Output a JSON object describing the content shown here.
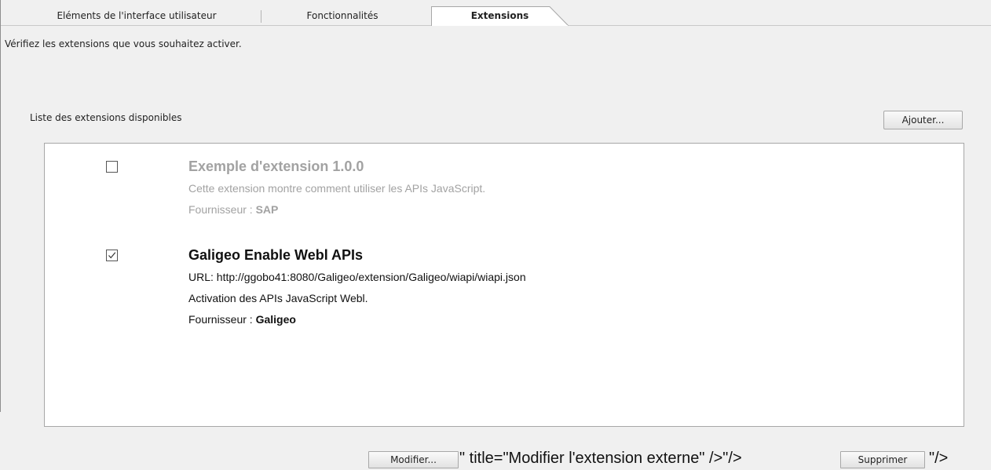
{
  "tabs": [
    {
      "label": "Eléments de l'interface utilisateur",
      "active": false
    },
    {
      "label": "Fonctionnalités",
      "active": false
    },
    {
      "label": "Extensions",
      "active": true
    }
  ],
  "instructions": "Vérifiez les extensions que vous souhaitez activer.",
  "list_label": "Liste des extensions disponibles",
  "add_button_label": "Ajouter...",
  "extensions": [
    {
      "enabled": false,
      "title": "Exemple d'extension 1.0.0",
      "description": "Cette extension montre comment utiliser les APIs JavaScript.",
      "provider_label": "Fournisseur : ",
      "provider": "SAP"
    },
    {
      "enabled": true,
      "title": "Galigeo Enable Webl APIs",
      "url_line": "URL: http://ggobo41:8080/Galigeo/extension/Galigeo/wiapi/wiapi.json",
      "description": "Activation des APIs JavaScript Webl.",
      "provider_label": "Fournisseur : ",
      "provider": "Galigeo",
      "modify_label": "Modifier...",
      "modify_trailing_text": "\" title=\"Modifier l'extension externe\" />\"/>",
      "delete_label": "Supprimer",
      "delete_trailing_text": "\"/>"
    }
  ],
  "colors": {
    "background": "#f0f0f0",
    "panel": "#ffffff",
    "disabled_text": "#a2a2a2",
    "border": "#a7a7a7"
  },
  "icons": {
    "checkbox_checked": "check-icon"
  }
}
